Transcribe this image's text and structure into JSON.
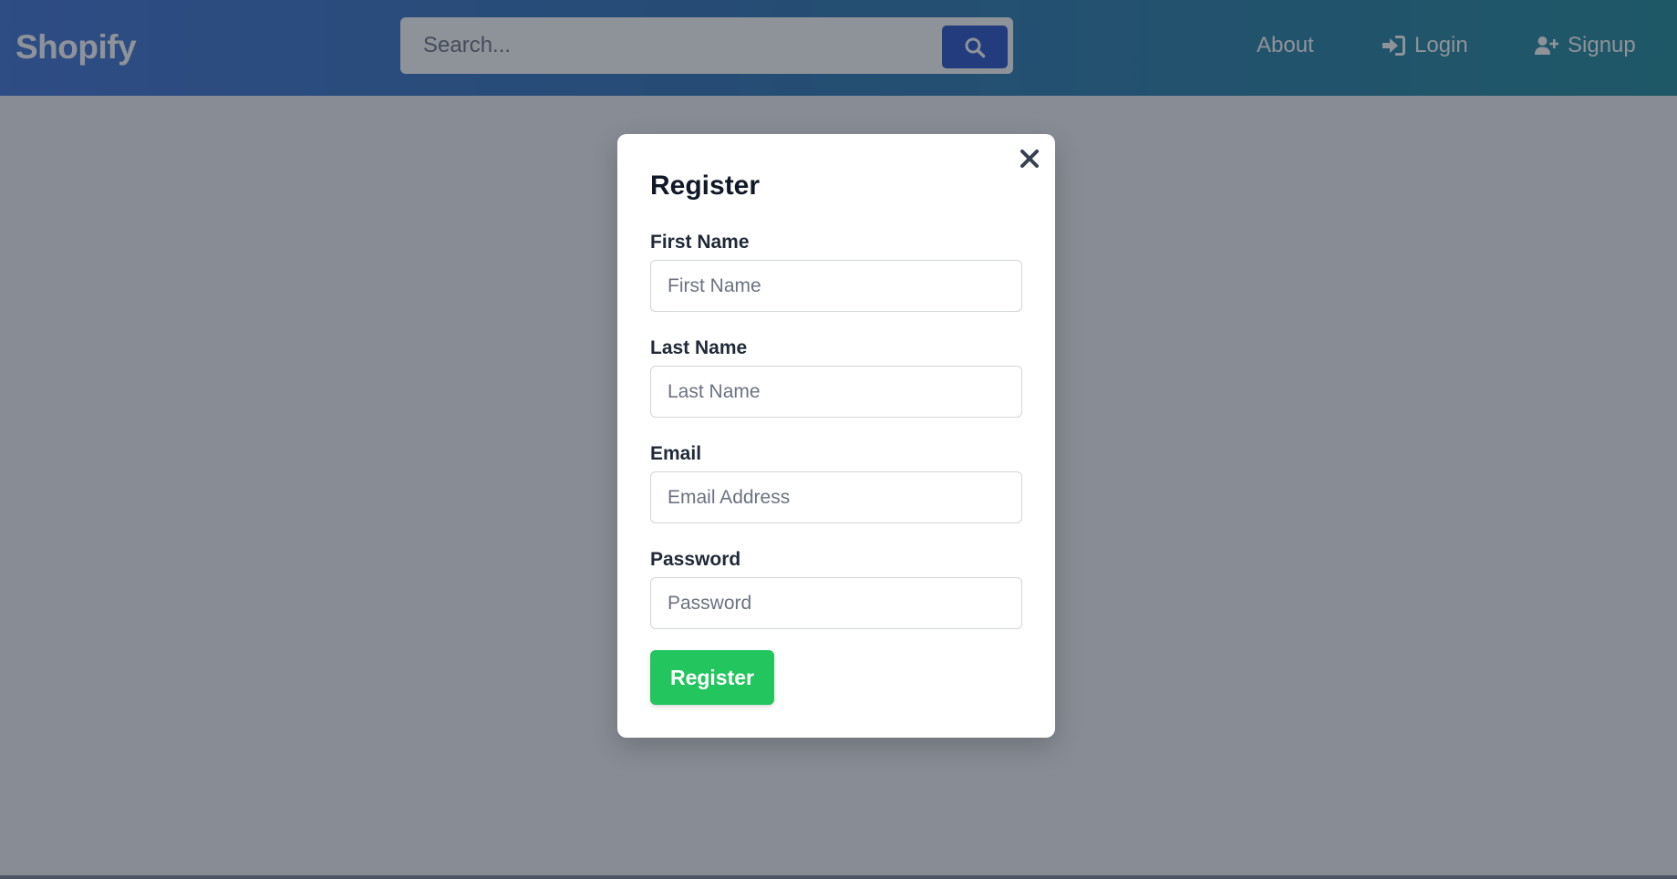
{
  "navbar": {
    "brand": "Shopify",
    "search": {
      "placeholder": "Search...",
      "value": "",
      "button_icon": "search-icon"
    },
    "links": [
      {
        "label": "About",
        "icon": ""
      },
      {
        "label": "Login",
        "icon": "sign-in-icon"
      },
      {
        "label": "Signup",
        "icon": "user-plus-icon"
      }
    ]
  },
  "modal": {
    "title": "Register",
    "close_icon": "close-icon",
    "fields": [
      {
        "label": "First Name",
        "placeholder": "First Name",
        "value": ""
      },
      {
        "label": "Last Name",
        "placeholder": "Last Name",
        "value": ""
      },
      {
        "label": "Email",
        "placeholder": "Email Address",
        "value": ""
      },
      {
        "label": "Password",
        "placeholder": "Password",
        "value": ""
      }
    ],
    "submit_label": "Register"
  },
  "colors": {
    "navbar_gradient_start": "#3f73d6",
    "navbar_gradient_end": "#1f8a9a",
    "search_button": "#2652c7",
    "register_button": "#22c55e",
    "overlay": "rgba(30,37,51,0.5)"
  }
}
